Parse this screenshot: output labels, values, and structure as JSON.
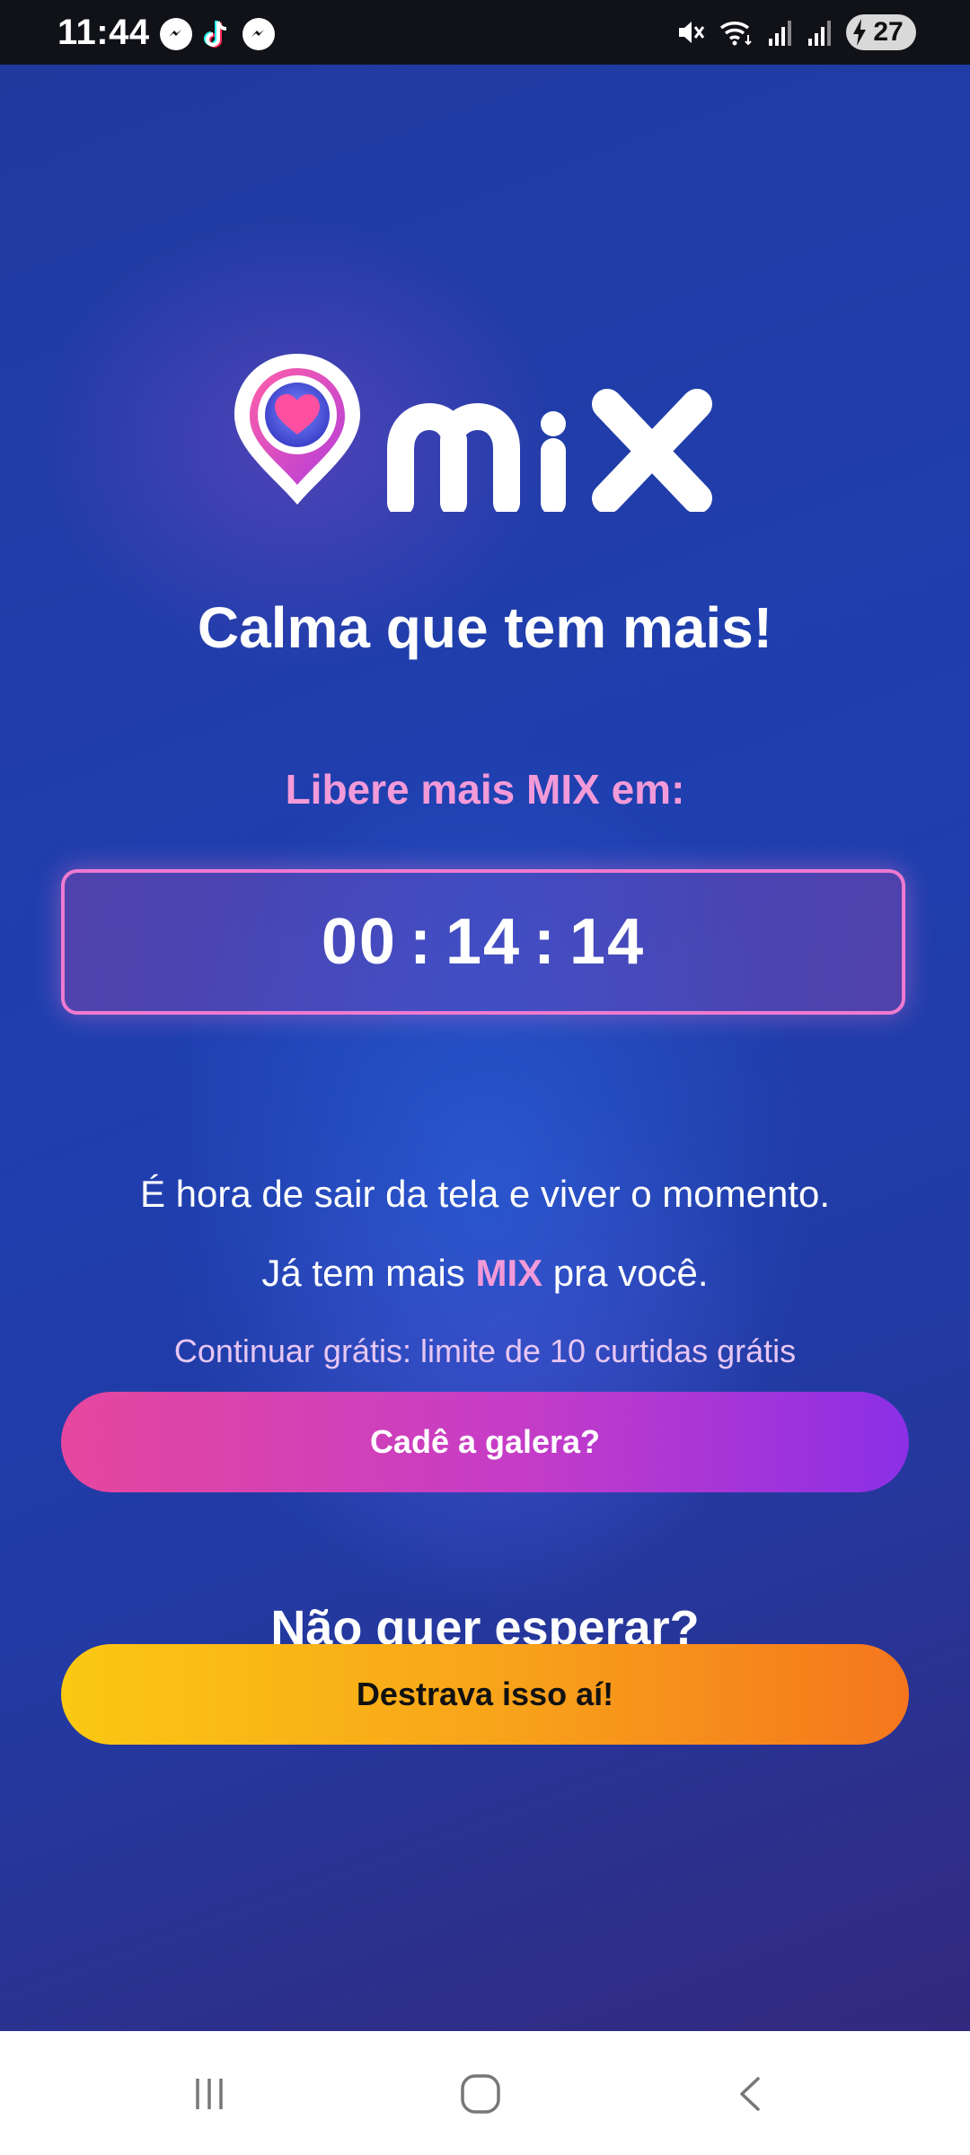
{
  "status_bar": {
    "time": "11:44",
    "left_icons": [
      "messenger-icon",
      "tiktok-icon",
      "messenger-icon"
    ],
    "right_icons": [
      "mute-icon",
      "wifi-icon",
      "signal-icon",
      "signal-icon"
    ],
    "battery_level": "27"
  },
  "app": {
    "logo_text": "mix",
    "headline": "Calma que tem mais!",
    "unlock_label": "Libere mais MIX em:",
    "timer": {
      "hours": "00",
      "minutes": "14",
      "seconds": "14",
      "separator": ":"
    },
    "message_line_1": "É hora de sair da tela e viver o momento.",
    "message_line_2_prefix": "Já tem mais ",
    "message_line_2_highlight": "MIX",
    "message_line_2_suffix": " pra você.",
    "free_note": "Continuar grátis: limite de 10 curtidas grátis",
    "crowd_button_label": "Cadê a galera?",
    "wait_title": "Não quer esperar?",
    "unlock_button_label": "Destrava isso aí!"
  },
  "colors": {
    "accent_pink": "#f39ad8",
    "crowd_button_gradient": [
      "#e6479e",
      "#8b2fe6"
    ],
    "unlock_button_gradient": [
      "#fbc813",
      "#f5761d"
    ],
    "background": "#1f3aa8"
  },
  "nav_bar": {
    "buttons": [
      "recent-apps-icon",
      "home-icon",
      "back-icon"
    ]
  }
}
